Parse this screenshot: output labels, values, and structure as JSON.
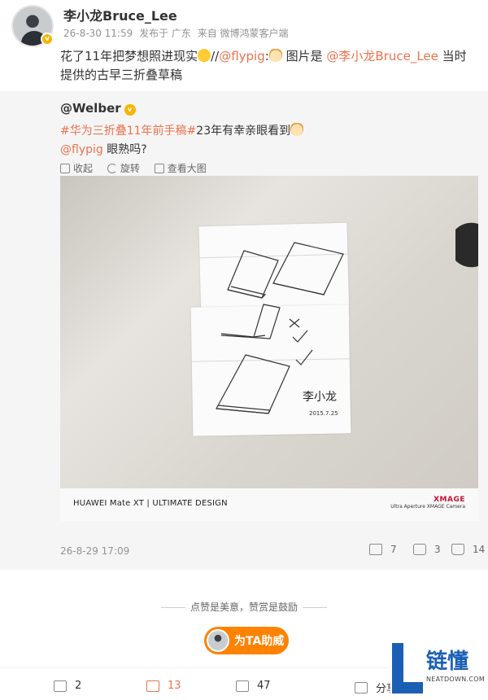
{
  "post": {
    "author": "李小龙Bruce_Lee",
    "verified_mark": "v",
    "meta": {
      "date": "26-8-30 11:59",
      "published_in": "发布于 广东",
      "source": "来自 微博鸿蒙客户端"
    },
    "text_parts": {
      "p1": "花了11年把梦想照进现实",
      "p2": "//",
      "p3": "@flypig",
      "p4": ":",
      "p5": "图片是 ",
      "p6": "@李小龙Bruce_Lee",
      "p7": " 当时提供的古早三折叠草稿"
    }
  },
  "repost": {
    "author": "@Welber",
    "verified_mark": "v",
    "line1": {
      "hashtag": "#华为三折叠11年前手稿#",
      "text": "23年有幸亲眼看到"
    },
    "line2": {
      "mention": "@flypig",
      "text": " 眼熟吗?"
    },
    "tools": {
      "collapse": "收起",
      "rotate": "旋转",
      "view_large": "查看大图"
    },
    "photo": {
      "brand": "HUAWEI Mate XT | ULTIMATE DESIGN",
      "xmage": "XMAGE",
      "camera": "Ultra Aperture XMAGE Camera",
      "signature": "李小龙",
      "sign_date": "2015.7.25"
    },
    "time": "26-8-29 17:09",
    "stats": {
      "reposts": "7",
      "comments": "3",
      "likes": "14"
    }
  },
  "praise": {
    "text": "点赞是美意，赞赏是鼓励",
    "cheer_label": "为TA助威"
  },
  "footer": {
    "reposts": "2",
    "comments": "13",
    "likes": "47",
    "share": "分享"
  },
  "watermark": {
    "text": "链懂",
    "domain": "NEATDOWN.COM"
  },
  "colors": {
    "accent": "#eb7350",
    "cheer": "#ff8200",
    "badge": "#f7b500",
    "watermark": "#1b5fb5"
  }
}
